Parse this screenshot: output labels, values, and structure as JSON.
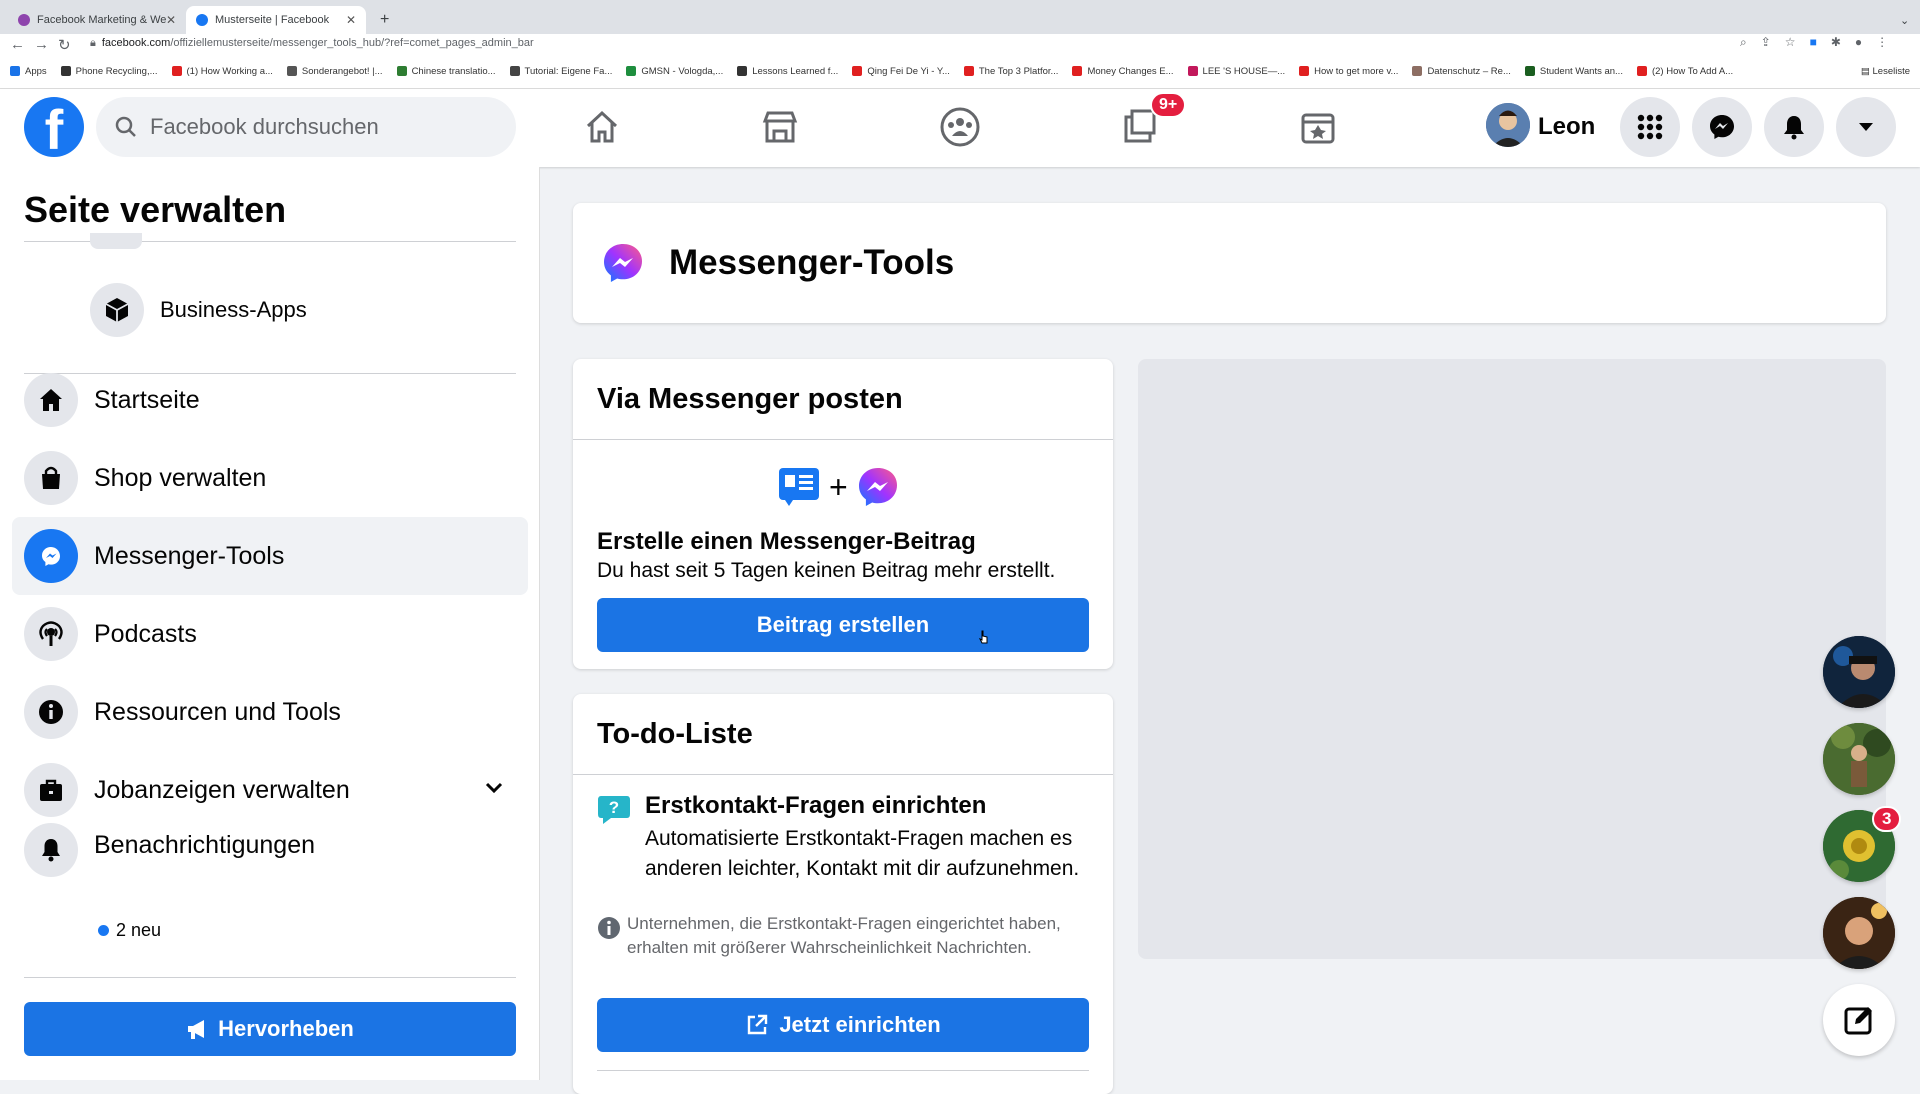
{
  "browser": {
    "tabs": [
      {
        "title": "Facebook Marketing & Werbe..."
      },
      {
        "title": "Musterseite | Facebook"
      }
    ],
    "url_domain": "facebook.com",
    "url_path": "/offiziellemusterseite/messenger_tools_hub/?ref=comet_pages_admin_bar",
    "bookmarks": [
      "Apps",
      "Phone Recycling,...",
      "(1) How Working a...",
      "Sonderangebot! |...",
      "Chinese translatio...",
      "Tutorial: Eigene Fa...",
      "GMSN - Vologda,...",
      "Lessons Learned f...",
      "Qing Fei De Yi - Y...",
      "The Top 3 Platfor...",
      "Money Changes E...",
      "LEE 'S HOUSE—...",
      "How to get more v...",
      "Datenschutz – Re...",
      "Student Wants an...",
      "(2) How To Add A..."
    ],
    "reading_list": "Leseliste"
  },
  "header": {
    "search_placeholder": "Facebook durchsuchen",
    "nav_badge": "9+",
    "user_name": "Leon"
  },
  "sidebar": {
    "title": "Seite verwalten",
    "top_item": "Business-Apps",
    "items": [
      {
        "label": "Startseite",
        "icon": "home-icon"
      },
      {
        "label": "Shop verwalten",
        "icon": "shopping-bag-icon"
      },
      {
        "label": "Messenger-Tools",
        "icon": "messenger-icon"
      },
      {
        "label": "Podcasts",
        "icon": "podcast-icon"
      },
      {
        "label": "Ressourcen und Tools",
        "icon": "info-icon"
      },
      {
        "label": "Jobanzeigen verwalten",
        "icon": "briefcase-icon"
      },
      {
        "label": "Benachrichtigungen",
        "icon": "bell-icon"
      }
    ],
    "notif_sub": "2 neu",
    "promote_button": "Hervorheben"
  },
  "main": {
    "page_title": "Messenger-Tools",
    "post_card": {
      "title": "Via Messenger posten",
      "heading": "Erstelle einen Messenger-Beitrag",
      "text": "Du hast seit 5 Tagen keinen Beitrag mehr erstellt.",
      "button": "Beitrag erstellen"
    },
    "todo_card": {
      "title": "To-do-Liste",
      "heading": "Erstkontakt-Fragen einrichten",
      "text": "Automatisierte Erstkontakt-Fragen machen es anderen leichter, Kontakt mit dir aufzunehmen.",
      "info": "Unternehmen, die Erstkontakt-Fragen eingerichtet haben, erhalten mit größerer Wahrscheinlichkeit Nachrichten.",
      "button": "Jetzt einrichten"
    }
  },
  "chat_heads": {
    "badge": "3"
  },
  "colors": {
    "brand": "#1877f2",
    "button": "#1b74e4",
    "badge": "#e41e3f"
  }
}
